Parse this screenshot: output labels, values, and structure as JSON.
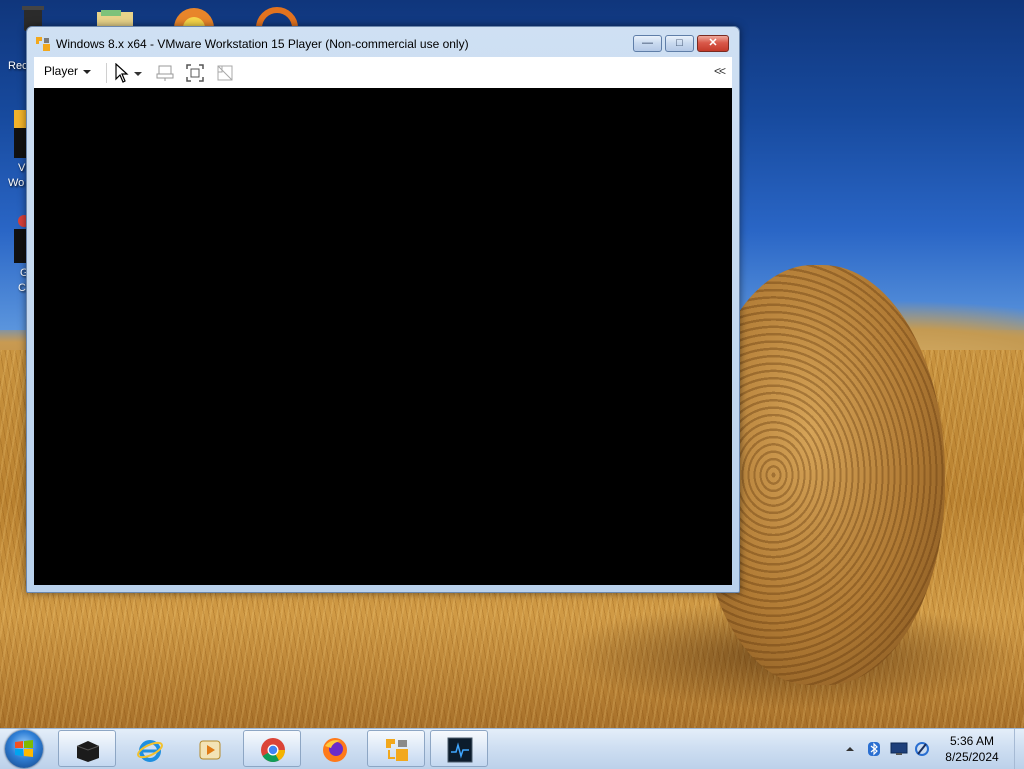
{
  "desktop": {
    "icons": [
      {
        "name": "recycle-bin",
        "label": "Rec"
      },
      {
        "name": "vmware-workstation-shortcut",
        "label_line1": "V",
        "label_line2": "Wo"
      },
      {
        "name": "google-chrome-shortcut",
        "label_line1": "G",
        "label_line2": "C"
      }
    ]
  },
  "window": {
    "title": "Windows 8.x x64 - VMware Workstation 15 Player (Non-commercial use only)",
    "controls": {
      "minimize": "—",
      "maximize": "□",
      "close": "✕"
    },
    "toolbar": {
      "player_menu": "Player",
      "icons": [
        "cursor-arrow-icon",
        "send-ctrl-alt-del-icon",
        "fullscreen-icon",
        "unity-icon"
      ],
      "collapse": "<<"
    }
  },
  "taskbar": {
    "items": [
      {
        "name": "start-button",
        "icon": "windows-logo-icon"
      },
      {
        "name": "taskbar-terminal",
        "icon": "black-box-icon"
      },
      {
        "name": "taskbar-internet-explorer",
        "icon": "internet-explorer-icon"
      },
      {
        "name": "taskbar-media-player",
        "icon": "media-player-icon"
      },
      {
        "name": "taskbar-chrome",
        "icon": "chrome-icon",
        "active": true
      },
      {
        "name": "taskbar-firefox",
        "icon": "firefox-icon"
      },
      {
        "name": "taskbar-vmware",
        "icon": "vmware-icon",
        "active": true
      },
      {
        "name": "taskbar-monitor",
        "icon": "monitor-icon",
        "active": true
      }
    ],
    "tray": {
      "icons": [
        "show-hidden-icons-icon",
        "bluetooth-icon",
        "display-icon",
        "network-icon"
      ],
      "time": "5:36 AM",
      "date": "8/25/2024"
    }
  }
}
